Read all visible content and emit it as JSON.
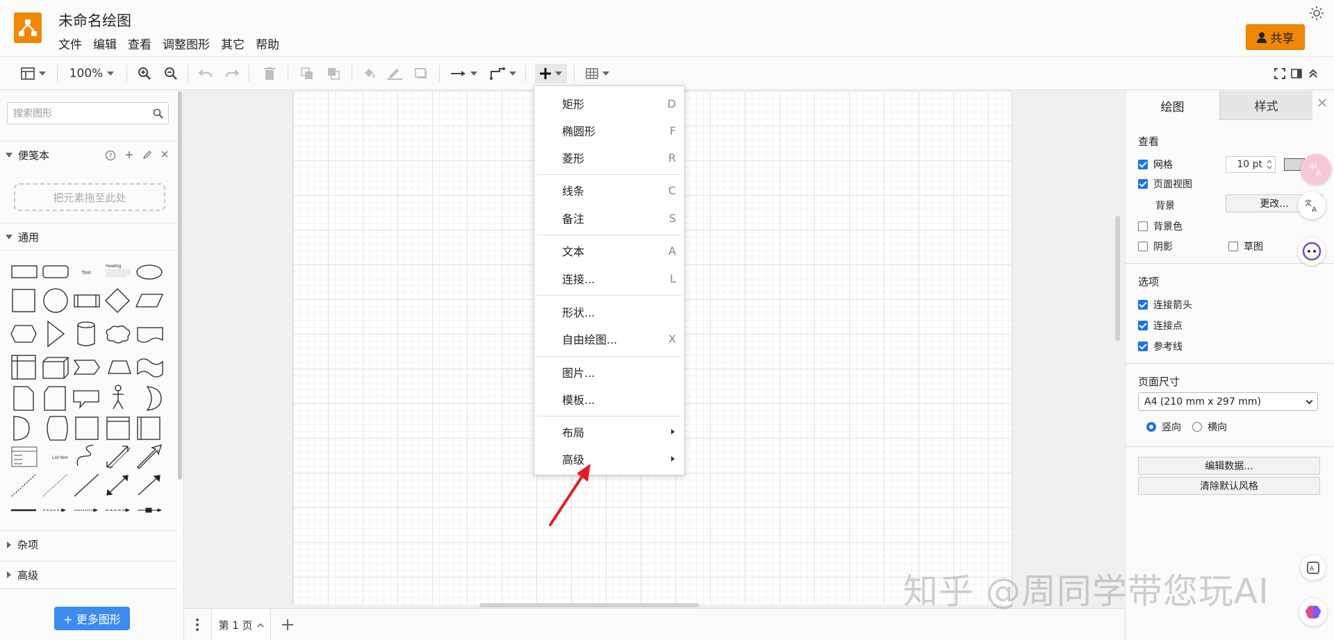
{
  "app": {
    "title": "未命名绘图",
    "share_label": "共享",
    "menus": [
      "文件",
      "编辑",
      "查看",
      "调整图形",
      "其它",
      "帮助"
    ],
    "accent_color": "#f08705"
  },
  "toolbar": {
    "zoom": "100%"
  },
  "left_panel": {
    "search_placeholder": "搜索图形",
    "scratchpad_label": "便笺本",
    "drop_zone_text": "把元素拖至此处",
    "general_label": "通用",
    "misc_label": "杂项",
    "advanced_label": "高级",
    "more_shapes_label": "+ 更多图形",
    "shape_texts": {
      "text": "Text",
      "heading": "Heading",
      "list_item": "List Item"
    }
  },
  "insert_menu": {
    "items": [
      {
        "label": "矩形",
        "key": "D"
      },
      {
        "label": "椭圆形",
        "key": "F"
      },
      {
        "label": "菱形",
        "key": "R"
      },
      {
        "label": "线条",
        "key": "C"
      },
      {
        "label": "备注",
        "key": "S"
      },
      {
        "label": "文本",
        "key": "A"
      },
      {
        "label": "连接...",
        "key": "L"
      },
      {
        "label": "形状...",
        "key": ""
      },
      {
        "label": "自由绘图...",
        "key": "X"
      },
      {
        "label": "图片...",
        "key": ""
      },
      {
        "label": "模板...",
        "key": ""
      },
      {
        "label": "布局",
        "key": ""
      },
      {
        "label": "高级",
        "key": ""
      }
    ]
  },
  "bottom_bar": {
    "page_tab": "第 1 页"
  },
  "right_panel": {
    "tab_diagram": "绘图",
    "tab_style": "样式",
    "view_heading": "查看",
    "grid_label": "网格",
    "grid_size": "10 pt",
    "page_view_label": "页面视图",
    "background_label": "背景",
    "change_label": "更改...",
    "bg_color_label": "背景色",
    "shadow_label": "阴影",
    "sketch_label": "草图",
    "options_heading": "选项",
    "connection_arrows_label": "连接箭头",
    "connection_points_label": "连接点",
    "guides_label": "参考线",
    "page_size_heading": "页面尺寸",
    "page_size_value": "A4 (210 mm x 297 mm)",
    "portrait_label": "竖向",
    "landscape_label": "横向",
    "edit_data_label": "编辑数据...",
    "clear_style_label": "清除默认风格",
    "checkboxes": {
      "grid": true,
      "page_view": true,
      "bg_color": false,
      "shadow": false,
      "sketch": false,
      "connection_arrows": true,
      "connection_points": true,
      "guides": true
    },
    "orientation": "portrait"
  },
  "watermark": "知乎 @周同学带您玩AI"
}
